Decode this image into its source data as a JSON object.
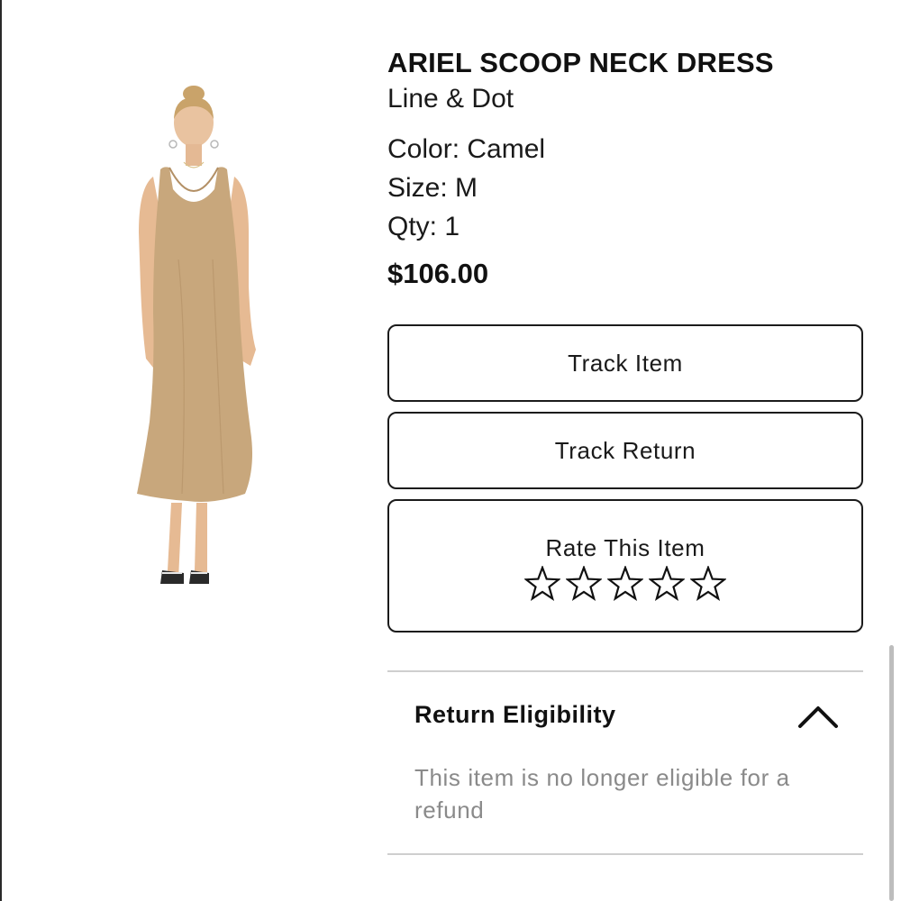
{
  "product": {
    "title": "ARIEL SCOOP NECK DRESS",
    "brand": "Line & Dot",
    "color": "Color: Camel",
    "size": "Size: M",
    "qty": "Qty: 1",
    "price": "$106.00",
    "image_icon": "dress-photo",
    "dress_color": "#c8a77c"
  },
  "actions": {
    "track_item": "Track Item",
    "track_return": "Track Return",
    "rate_label": "Rate This Item",
    "rating": 0,
    "rating_max": 5
  },
  "return_eligibility": {
    "title": "Return Eligibility",
    "message": "This item is no longer eligible for a refund",
    "expanded": true,
    "toggle_icon": "chevron-up-icon"
  }
}
